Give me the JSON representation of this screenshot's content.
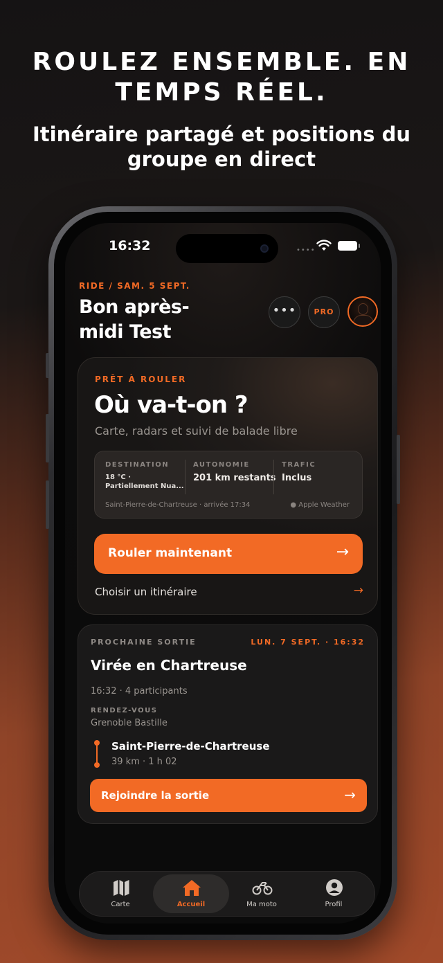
{
  "hero": {
    "title_line1": "ROULEZ ENSEMBLE. EN",
    "title_line2": "TEMPS RÉEL.",
    "subtitle_line1": "Itinéraire partagé et positions du",
    "subtitle_line2": "groupe en direct"
  },
  "status_bar": {
    "time": "16:32"
  },
  "header": {
    "eyebrow": "RIDE / SAM. 5 SEPT.",
    "greeting": "Bon après-midi Test",
    "more_label": "•••",
    "pro_label": "PRO"
  },
  "ride_card": {
    "eyebrow": "PRÊT À ROULER",
    "title": "Où va-t-on ?",
    "subtitle": "Carte, radars et suivi de balade libre",
    "info": {
      "destination_label": "DESTINATION",
      "destination_value": "18 °C · Partiellement Nua...",
      "autonomy_label": "AUTONOMIE",
      "autonomy_value": "201 km restants",
      "traffic_label": "TRAFIC",
      "traffic_value": "Inclus",
      "footer": "Saint-Pierre-de-Chartreuse · arrivée 17:34",
      "weather_source": "Apple Weather"
    },
    "primary_button": "Rouler maintenant",
    "secondary_link": "Choisir un itinéraire"
  },
  "next_ride": {
    "eyebrow": "PROCHAINE SORTIE",
    "date": "LUN. 7 SEPT. · 16:32",
    "title": "Virée en Chartreuse",
    "meta": "16:32  ·  4 participants",
    "meeting_label": "RENDEZ-VOUS",
    "meeting_place": "Grenoble Bastille",
    "destination": "Saint-Pierre-de-Chartreuse",
    "route_meta": "39 km · 1 h 02",
    "join_button": "Rejoindre la sortie"
  },
  "tabbar": {
    "items": [
      {
        "label": "Carte",
        "icon": "map-icon",
        "active": false
      },
      {
        "label": "Accueil",
        "icon": "home-icon",
        "active": true
      },
      {
        "label": "Ma moto",
        "icon": "motorcycle-icon",
        "active": false
      },
      {
        "label": "Profil",
        "icon": "profile-icon",
        "active": false
      }
    ]
  },
  "colors": {
    "accent": "#f26a25",
    "background_top": "#151314",
    "background_bottom": "#a14a2a",
    "card": "#1f1b19"
  }
}
